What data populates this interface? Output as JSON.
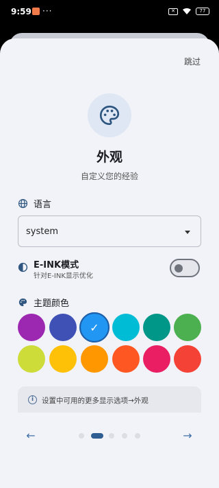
{
  "status": {
    "time": "9:59",
    "dots": "···",
    "battery": "77"
  },
  "header": {
    "skip": "跳过"
  },
  "hero": {
    "icon": "palette-icon",
    "title": "外观",
    "subtitle": "自定义您的经验"
  },
  "language": {
    "icon": "globe-icon",
    "label": "语言",
    "value": "system"
  },
  "eink": {
    "icon": "contrast-icon",
    "title": "E-INK模式",
    "description": "针对E-INK显示优化",
    "enabled": false
  },
  "theme": {
    "icon": "palette-icon",
    "label": "主题颜色",
    "colors": [
      "#9c27b0",
      "#3f51b5",
      "#2196f3",
      "#00bcd4",
      "#009688",
      "#4caf50",
      "#cddc39",
      "#ffc107",
      "#ff9800",
      "#ff5722",
      "#e91e63",
      "#f44336"
    ],
    "selected_index": 2
  },
  "info": {
    "icon": "info-icon",
    "text": "设置中可用的更多显示选项→外观"
  },
  "nav": {
    "back": "←",
    "next": "→",
    "pages": 5,
    "current": 1
  }
}
